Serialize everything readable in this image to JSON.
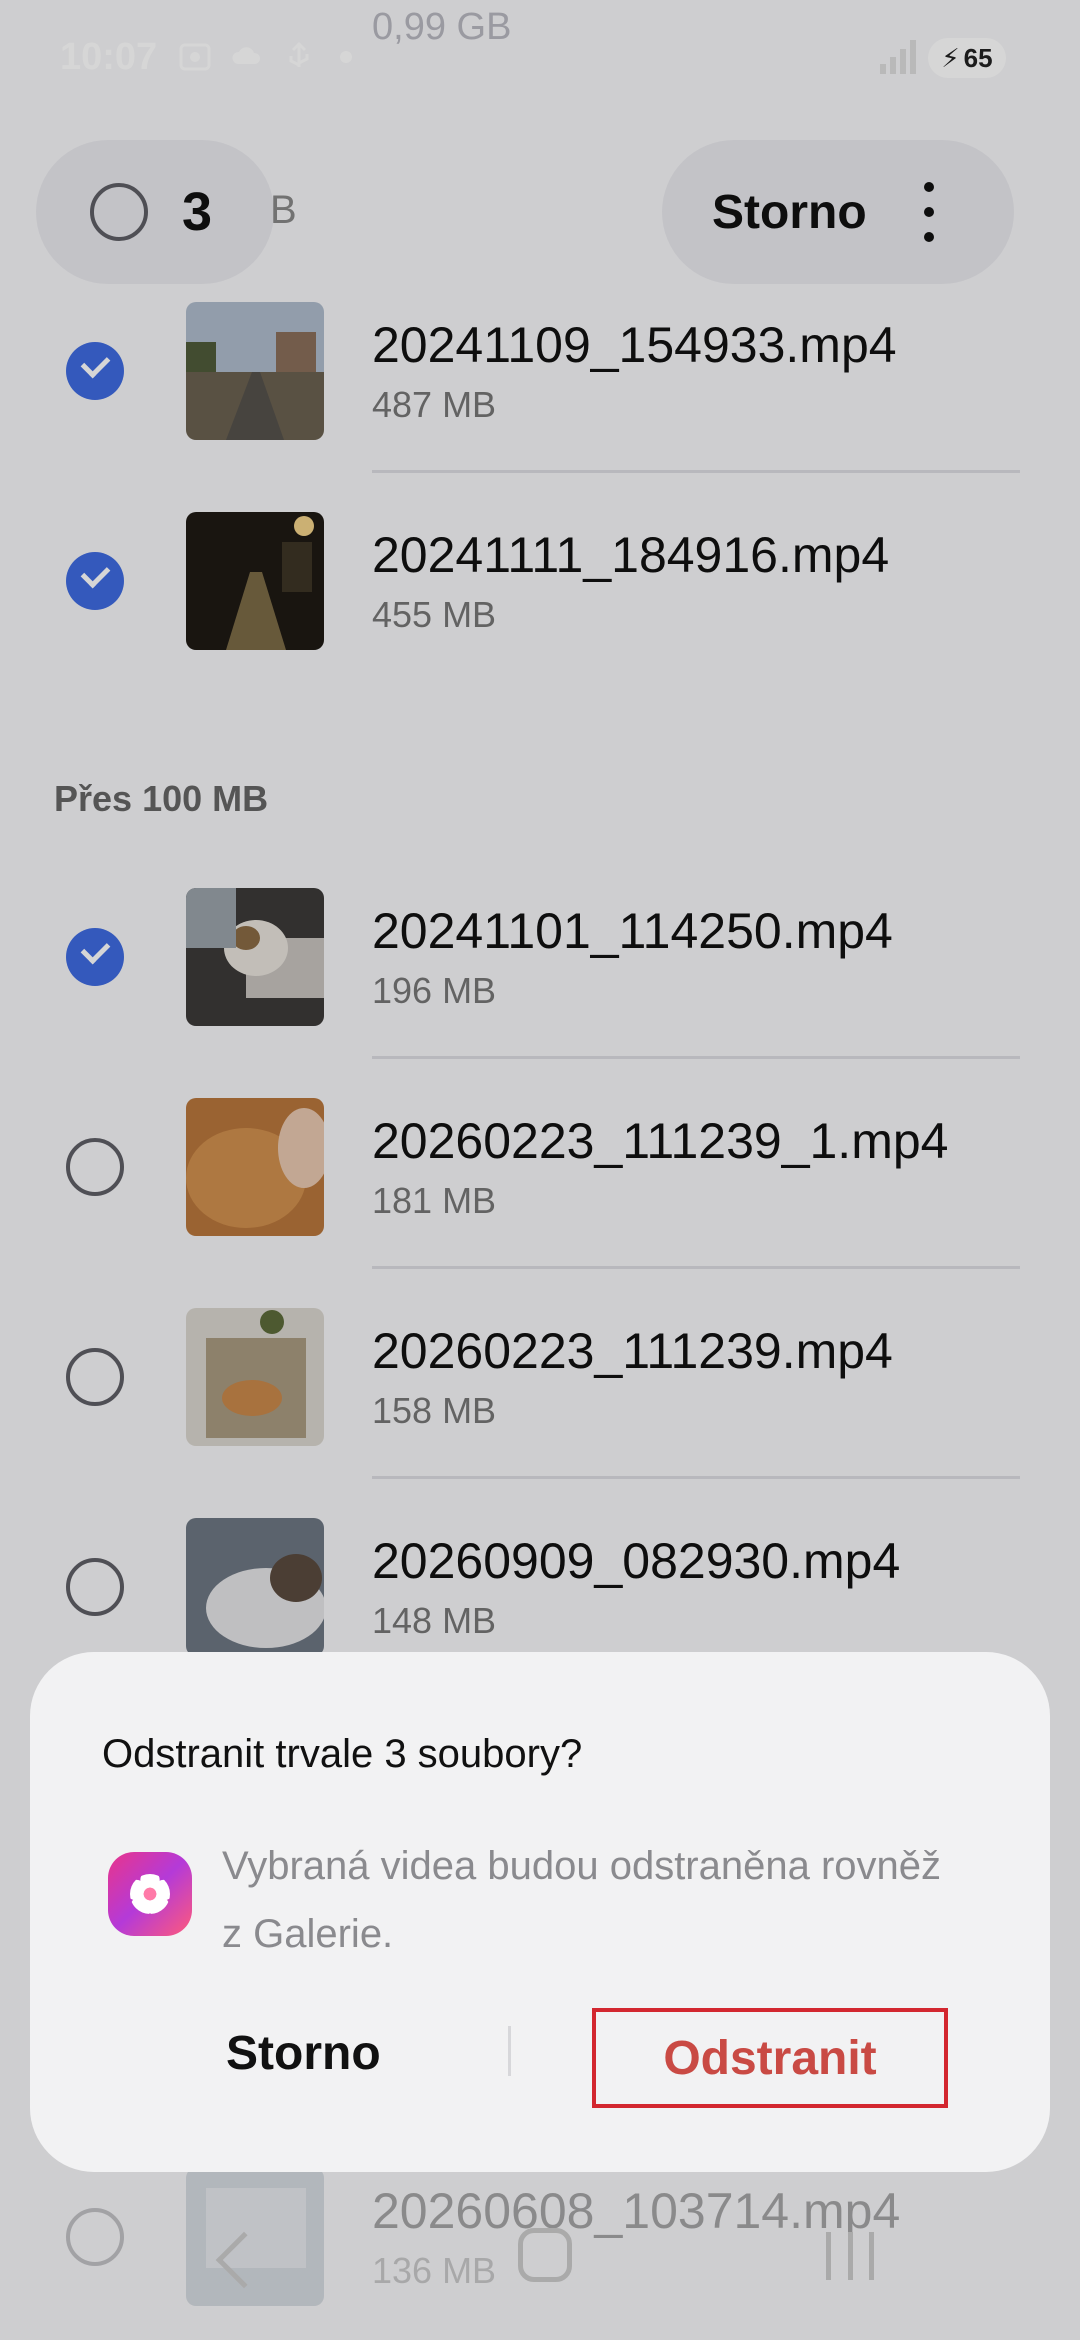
{
  "status_bar": {
    "time": "10:07",
    "battery": "65",
    "icons": [
      "screenshot-icon",
      "cloud-icon",
      "usb-icon",
      "dot-icon"
    ]
  },
  "background_fragment": "0,99 GB",
  "top_bar": {
    "selected_count": "3",
    "fragment": "B",
    "cancel_label": "Storno"
  },
  "sections": [
    {
      "items": [
        {
          "name": "20241109_154933.mp4",
          "size": "487 MB",
          "checked": true
        },
        {
          "name": "20241111_184916.mp4",
          "size": "455 MB",
          "checked": true
        }
      ]
    },
    {
      "label": "Přes 100 MB",
      "items": [
        {
          "name": "20241101_114250.mp4",
          "size": "196 MB",
          "checked": true
        },
        {
          "name": "20260223_111239_1.mp4",
          "size": "181 MB",
          "checked": false
        },
        {
          "name": "20260223_111239.mp4",
          "size": "158 MB",
          "checked": false
        },
        {
          "name": "20260909_082930.mp4",
          "size": "148 MB",
          "checked": false
        },
        {
          "name": "20260608_103714.mp4",
          "size": "136 MB",
          "checked": false
        }
      ]
    }
  ],
  "dialog": {
    "title": "Odstranit trvale 3 soubory?",
    "message": "Vybraná videa budou odstraněna rovněž z Galerie.",
    "cancel_label": "Storno",
    "confirm_label": "Odstranit",
    "confirm_color": "#c94a44",
    "icon": "gallery-app-icon"
  },
  "colors": {
    "accent": "#3f6be0",
    "highlight_border": "#d3272f"
  }
}
